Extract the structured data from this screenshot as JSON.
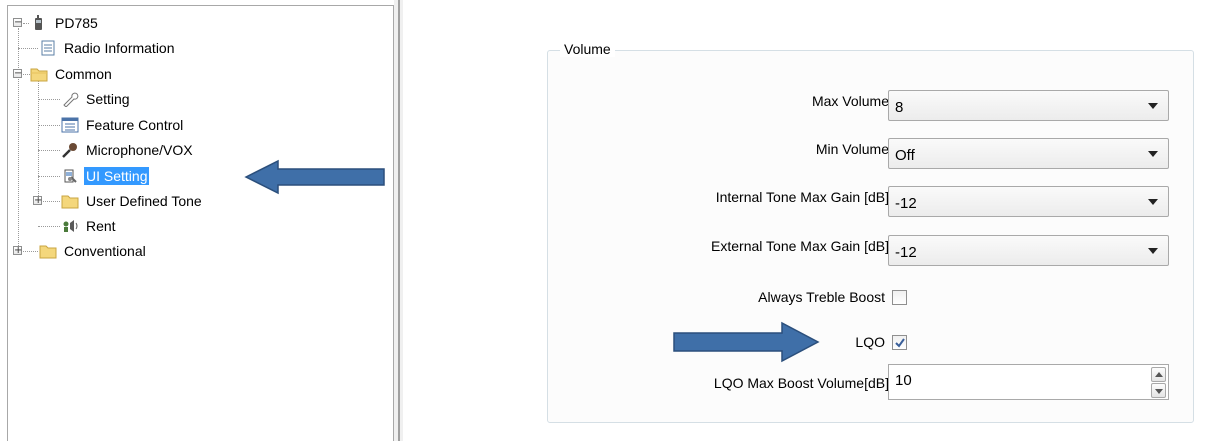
{
  "tree": {
    "root": {
      "label": "PD785",
      "icon": "radio-device-icon",
      "expanded": true
    },
    "items": [
      {
        "label": "Radio Information",
        "icon": "document-list-icon"
      },
      {
        "label": "Common",
        "icon": "folder-open-icon",
        "expanded": true
      },
      {
        "label": "Setting",
        "icon": "wrench-icon"
      },
      {
        "label": "Feature Control",
        "icon": "list-icon"
      },
      {
        "label": "Microphone/VOX",
        "icon": "microphone-icon"
      },
      {
        "label": "UI Setting",
        "icon": "ui-setting-icon",
        "selected": true
      },
      {
        "label": "User Defined Tone",
        "icon": "folder-icon",
        "expanded": false
      },
      {
        "label": "Rent",
        "icon": "rent-icon"
      },
      {
        "label": "Conventional",
        "icon": "folder-icon",
        "expanded": false
      }
    ]
  },
  "volume_group": {
    "title": "Volume",
    "max_volume": {
      "label": "Max Volume",
      "value": "8"
    },
    "min_volume": {
      "label": "Min Volume",
      "value": "Off"
    },
    "internal_tone": {
      "label": "Internal Tone Max Gain [dB]",
      "value": "-12"
    },
    "external_tone": {
      "label": "External Tone Max Gain [dB]",
      "value": "-12"
    },
    "treble_boost": {
      "label": "Always Treble Boost",
      "checked": false
    },
    "lqo": {
      "label": "LQO",
      "checked": true
    },
    "lqo_max_boost": {
      "label": "LQO Max Boost Volume[dB]",
      "value": "10"
    }
  },
  "colors": {
    "selection": "#3399ff",
    "annotation_arrow": "#3f6fa8",
    "annotation_arrow_border": "#2b4f7c"
  }
}
